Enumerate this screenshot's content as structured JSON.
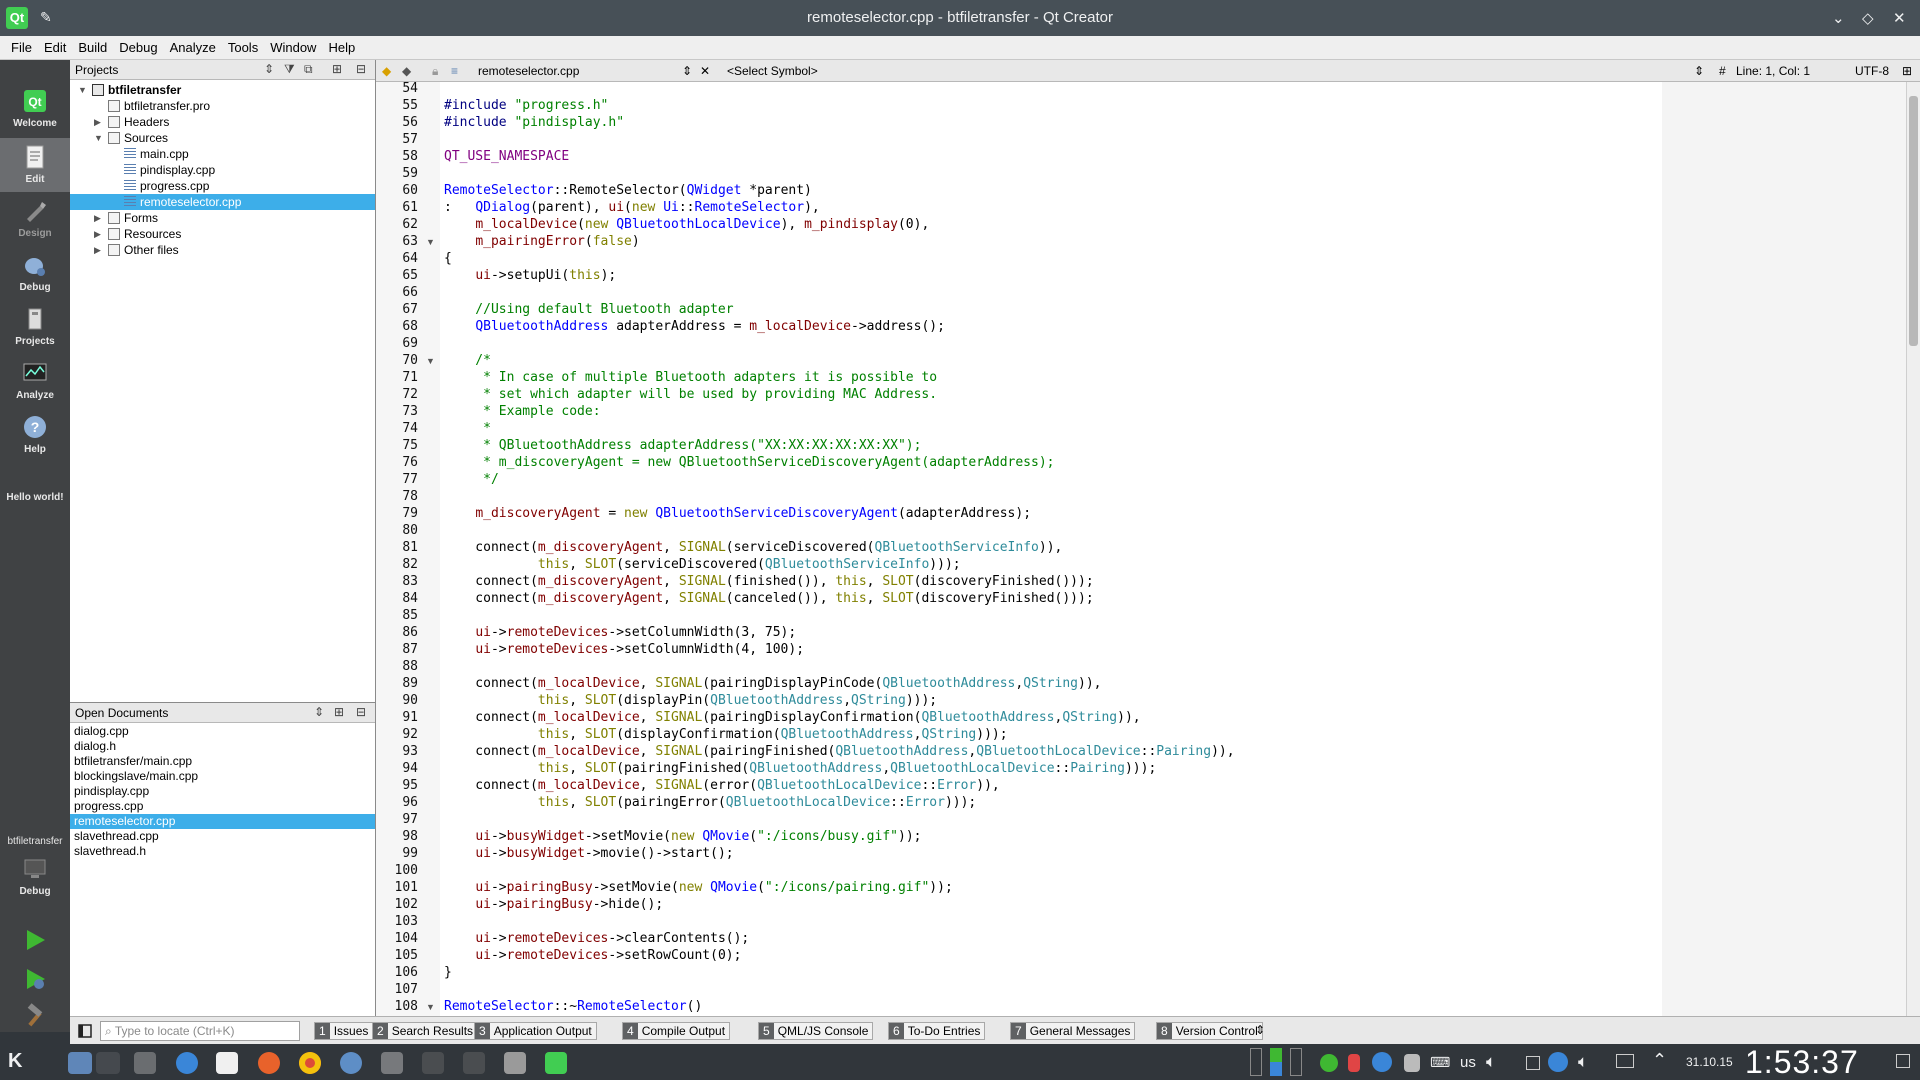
{
  "window": {
    "title": "remoteselector.cpp - btfiletransfer - Qt Creator",
    "app_icon": "Qt"
  },
  "menu": [
    "File",
    "Edit",
    "Build",
    "Debug",
    "Analyze",
    "Tools",
    "Window",
    "Help"
  ],
  "modes": [
    {
      "label": "Welcome",
      "icon": "qt-logo-icon"
    },
    {
      "label": "Edit",
      "icon": "edit-document-icon"
    },
    {
      "label": "Design",
      "icon": "design-pen-icon"
    },
    {
      "label": "Debug",
      "icon": "debug-bug-icon"
    },
    {
      "label": "Projects",
      "icon": "projects-wrench-icon"
    },
    {
      "label": "Analyze",
      "icon": "analyze-monitor-icon"
    },
    {
      "label": "Help",
      "icon": "help-question-icon"
    }
  ],
  "modebar": {
    "hello": "Hello world!",
    "kit_project": "btfiletransfer",
    "kit_mode": "Debug"
  },
  "projects": {
    "header": "Projects",
    "tree": [
      {
        "label": "btfiletransfer",
        "level": 0,
        "arrow": "▼",
        "icon": "project"
      },
      {
        "label": "btfiletransfer.pro",
        "level": 1,
        "arrow": "",
        "icon": "file"
      },
      {
        "label": "Headers",
        "level": 1,
        "arrow": "▶",
        "icon": "folder"
      },
      {
        "label": "Sources",
        "level": 1,
        "arrow": "▼",
        "icon": "folder"
      },
      {
        "label": "main.cpp",
        "level": 2,
        "arrow": "",
        "icon": "cpp"
      },
      {
        "label": "pindisplay.cpp",
        "level": 2,
        "arrow": "",
        "icon": "cpp"
      },
      {
        "label": "progress.cpp",
        "level": 2,
        "arrow": "",
        "icon": "cpp"
      },
      {
        "label": "remoteselector.cpp",
        "level": 2,
        "arrow": "",
        "icon": "cpp",
        "selected": true
      },
      {
        "label": "Forms",
        "level": 1,
        "arrow": "▶",
        "icon": "folder"
      },
      {
        "label": "Resources",
        "level": 1,
        "arrow": "▶",
        "icon": "folder"
      },
      {
        "label": "Other files",
        "level": 1,
        "arrow": "▶",
        "icon": "folder"
      }
    ]
  },
  "open_documents": {
    "header": "Open Documents",
    "items": [
      "dialog.cpp",
      "dialog.h",
      "btfiletransfer/main.cpp",
      "blockingslave/main.cpp",
      "pindisplay.cpp",
      "progress.cpp",
      "remoteselector.cpp",
      "slavethread.cpp",
      "slavethread.h"
    ],
    "selected_index": 6
  },
  "editor_toolbar": {
    "file": "remoteselector.cpp",
    "symbol": "<Select Symbol>",
    "hash": "#",
    "position": "Line: 1, Col: 1",
    "encoding": "UTF-8"
  },
  "code": {
    "first_line": 54,
    "fold_lines": [
      63,
      70,
      108
    ],
    "lines": [
      [],
      [
        [
          "#include ",
          "pp"
        ],
        [
          "\"progress.h\"",
          "st"
        ]
      ],
      [
        [
          "#include ",
          "pp"
        ],
        [
          "\"pindisplay.h\"",
          "st"
        ]
      ],
      [],
      [
        [
          "QT_USE_NAMESPACE",
          "mc"
        ]
      ],
      [],
      [
        [
          "RemoteSelector",
          "ty"
        ],
        [
          "::RemoteSelector(",
          ""
        ],
        [
          "QWidget",
          "ty"
        ],
        [
          " *parent)",
          ""
        ]
      ],
      [
        [
          ":   ",
          ""
        ],
        [
          "QDialog",
          "ty"
        ],
        [
          "(parent), ",
          ""
        ],
        [
          "ui",
          "mb"
        ],
        [
          "(",
          ""
        ],
        [
          "new ",
          "kw"
        ],
        [
          "Ui",
          "ty"
        ],
        [
          "::",
          ""
        ],
        [
          "RemoteSelector",
          "ty"
        ],
        [
          "),",
          ""
        ]
      ],
      [
        [
          "    ",
          ""
        ],
        [
          "m_localDevice",
          "mb"
        ],
        [
          "(",
          ""
        ],
        [
          "new ",
          "kw"
        ],
        [
          "QBluetoothLocalDevice",
          "ty"
        ],
        [
          "), ",
          ""
        ],
        [
          "m_pindisplay",
          "mb"
        ],
        [
          "(0),",
          ""
        ]
      ],
      [
        [
          "    ",
          ""
        ],
        [
          "m_pairingError",
          "mb"
        ],
        [
          "(",
          ""
        ],
        [
          "false",
          "kw"
        ],
        [
          ")",
          ""
        ]
      ],
      [
        [
          "{",
          ""
        ]
      ],
      [
        [
          "    ",
          ""
        ],
        [
          "ui",
          "mb"
        ],
        [
          "->setupUi(",
          ""
        ],
        [
          "this",
          "kw"
        ],
        [
          ");",
          ""
        ]
      ],
      [],
      [
        [
          "    //Using default Bluetooth adapter",
          "cm"
        ]
      ],
      [
        [
          "    ",
          ""
        ],
        [
          "QBluetoothAddress",
          "ty"
        ],
        [
          " adapterAddress = ",
          ""
        ],
        [
          "m_localDevice",
          "mb"
        ],
        [
          "->address();",
          ""
        ]
      ],
      [],
      [
        [
          "    /*",
          "cm"
        ]
      ],
      [
        [
          "     * In case of multiple Bluetooth adapters it is possible to",
          "cm"
        ]
      ],
      [
        [
          "     * set which adapter will be used by providing MAC Address.",
          "cm"
        ]
      ],
      [
        [
          "     * Example code:",
          "cm"
        ]
      ],
      [
        [
          "     *",
          "cm"
        ]
      ],
      [
        [
          "     * QBluetoothAddress adapterAddress(\"XX:XX:XX:XX:XX:XX\");",
          "cm"
        ]
      ],
      [
        [
          "     * m_discoveryAgent = new QBluetoothServiceDiscoveryAgent(adapterAddress);",
          "cm"
        ]
      ],
      [
        [
          "     */",
          "cm"
        ]
      ],
      [],
      [
        [
          "    ",
          ""
        ],
        [
          "m_discoveryAgent",
          "mb"
        ],
        [
          " = ",
          ""
        ],
        [
          "new ",
          "kw"
        ],
        [
          "QBluetoothServiceDiscoveryAgent",
          "ty"
        ],
        [
          "(adapterAddress);",
          ""
        ]
      ],
      [],
      [
        [
          "    connect(",
          ""
        ],
        [
          "m_discoveryAgent",
          "mb"
        ],
        [
          ", ",
          ""
        ],
        [
          "SIGNAL",
          "kw"
        ],
        [
          "(serviceDiscovered(",
          ""
        ],
        [
          "QBluetoothServiceInfo",
          "ty2"
        ],
        [
          ")),",
          ""
        ]
      ],
      [
        [
          "            ",
          ""
        ],
        [
          "this",
          "kw"
        ],
        [
          ", ",
          ""
        ],
        [
          "SLOT",
          "kw"
        ],
        [
          "(serviceDiscovered(",
          ""
        ],
        [
          "QBluetoothServiceInfo",
          "ty2"
        ],
        [
          ")));",
          ""
        ]
      ],
      [
        [
          "    connect(",
          ""
        ],
        [
          "m_discoveryAgent",
          "mb"
        ],
        [
          ", ",
          ""
        ],
        [
          "SIGNAL",
          "kw"
        ],
        [
          "(finished()), ",
          ""
        ],
        [
          "this",
          "kw"
        ],
        [
          ", ",
          ""
        ],
        [
          "SLOT",
          "kw"
        ],
        [
          "(discoveryFinished()));",
          ""
        ]
      ],
      [
        [
          "    connect(",
          ""
        ],
        [
          "m_discoveryAgent",
          "mb"
        ],
        [
          ", ",
          ""
        ],
        [
          "SIGNAL",
          "kw"
        ],
        [
          "(canceled()), ",
          ""
        ],
        [
          "this",
          "kw"
        ],
        [
          ", ",
          ""
        ],
        [
          "SLOT",
          "kw"
        ],
        [
          "(discoveryFinished()));",
          ""
        ]
      ],
      [],
      [
        [
          "    ",
          ""
        ],
        [
          "ui",
          "mb"
        ],
        [
          "->",
          ""
        ],
        [
          "remoteDevices",
          "mb"
        ],
        [
          "->setColumnWidth(3, 75);",
          ""
        ]
      ],
      [
        [
          "    ",
          ""
        ],
        [
          "ui",
          "mb"
        ],
        [
          "->",
          ""
        ],
        [
          "remoteDevices",
          "mb"
        ],
        [
          "->setColumnWidth(4, 100);",
          ""
        ]
      ],
      [],
      [
        [
          "    connect(",
          ""
        ],
        [
          "m_localDevice",
          "mb"
        ],
        [
          ", ",
          ""
        ],
        [
          "SIGNAL",
          "kw"
        ],
        [
          "(pairingDisplayPinCode(",
          ""
        ],
        [
          "QBluetoothAddress",
          "ty2"
        ],
        [
          ",",
          ""
        ],
        [
          "QString",
          "ty2"
        ],
        [
          ")),",
          ""
        ]
      ],
      [
        [
          "            ",
          ""
        ],
        [
          "this",
          "kw"
        ],
        [
          ", ",
          ""
        ],
        [
          "SLOT",
          "kw"
        ],
        [
          "(displayPin(",
          ""
        ],
        [
          "QBluetoothAddress",
          "ty2"
        ],
        [
          ",",
          ""
        ],
        [
          "QString",
          "ty2"
        ],
        [
          ")));",
          ""
        ]
      ],
      [
        [
          "    connect(",
          ""
        ],
        [
          "m_localDevice",
          "mb"
        ],
        [
          ", ",
          ""
        ],
        [
          "SIGNAL",
          "kw"
        ],
        [
          "(pairingDisplayConfirmation(",
          ""
        ],
        [
          "QBluetoothAddress",
          "ty2"
        ],
        [
          ",",
          ""
        ],
        [
          "QString",
          "ty2"
        ],
        [
          ")),",
          ""
        ]
      ],
      [
        [
          "            ",
          ""
        ],
        [
          "this",
          "kw"
        ],
        [
          ", ",
          ""
        ],
        [
          "SLOT",
          "kw"
        ],
        [
          "(displayConfirmation(",
          ""
        ],
        [
          "QBluetoothAddress",
          "ty2"
        ],
        [
          ",",
          ""
        ],
        [
          "QString",
          "ty2"
        ],
        [
          ")));",
          ""
        ]
      ],
      [
        [
          "    connect(",
          ""
        ],
        [
          "m_localDevice",
          "mb"
        ],
        [
          ", ",
          ""
        ],
        [
          "SIGNAL",
          "kw"
        ],
        [
          "(pairingFinished(",
          ""
        ],
        [
          "QBluetoothAddress",
          "ty2"
        ],
        [
          ",",
          ""
        ],
        [
          "QBluetoothLocalDevice",
          "ty2"
        ],
        [
          "::",
          ""
        ],
        [
          "Pairing",
          "ty2"
        ],
        [
          ")),",
          ""
        ]
      ],
      [
        [
          "            ",
          ""
        ],
        [
          "this",
          "kw"
        ],
        [
          ", ",
          ""
        ],
        [
          "SLOT",
          "kw"
        ],
        [
          "(pairingFinished(",
          ""
        ],
        [
          "QBluetoothAddress",
          "ty2"
        ],
        [
          ",",
          ""
        ],
        [
          "QBluetoothLocalDevice",
          "ty2"
        ],
        [
          "::",
          ""
        ],
        [
          "Pairing",
          "ty2"
        ],
        [
          ")));",
          ""
        ]
      ],
      [
        [
          "    connect(",
          ""
        ],
        [
          "m_localDevice",
          "mb"
        ],
        [
          ", ",
          ""
        ],
        [
          "SIGNAL",
          "kw"
        ],
        [
          "(error(",
          ""
        ],
        [
          "QBluetoothLocalDevice",
          "ty2"
        ],
        [
          "::",
          ""
        ],
        [
          "Error",
          "ty2"
        ],
        [
          ")),",
          ""
        ]
      ],
      [
        [
          "            ",
          ""
        ],
        [
          "this",
          "kw"
        ],
        [
          ", ",
          ""
        ],
        [
          "SLOT",
          "kw"
        ],
        [
          "(pairingError(",
          ""
        ],
        [
          "QBluetoothLocalDevice",
          "ty2"
        ],
        [
          "::",
          ""
        ],
        [
          "Error",
          "ty2"
        ],
        [
          ")));",
          ""
        ]
      ],
      [],
      [
        [
          "    ",
          ""
        ],
        [
          "ui",
          "mb"
        ],
        [
          "->",
          ""
        ],
        [
          "busyWidget",
          "mb"
        ],
        [
          "->setMovie(",
          ""
        ],
        [
          "new ",
          "kw"
        ],
        [
          "QMovie",
          "ty"
        ],
        [
          "(",
          ""
        ],
        [
          "\":/icons/busy.gif\"",
          "st"
        ],
        [
          "));",
          ""
        ]
      ],
      [
        [
          "    ",
          ""
        ],
        [
          "ui",
          "mb"
        ],
        [
          "->",
          ""
        ],
        [
          "busyWidget",
          "mb"
        ],
        [
          "->movie()->start();",
          ""
        ]
      ],
      [],
      [
        [
          "    ",
          ""
        ],
        [
          "ui",
          "mb"
        ],
        [
          "->",
          ""
        ],
        [
          "pairingBusy",
          "mb"
        ],
        [
          "->setMovie(",
          ""
        ],
        [
          "new ",
          "kw"
        ],
        [
          "QMovie",
          "ty"
        ],
        [
          "(",
          ""
        ],
        [
          "\":/icons/pairing.gif\"",
          "st"
        ],
        [
          "));",
          ""
        ]
      ],
      [
        [
          "    ",
          ""
        ],
        [
          "ui",
          "mb"
        ],
        [
          "->",
          ""
        ],
        [
          "pairingBusy",
          "mb"
        ],
        [
          "->hide();",
          ""
        ]
      ],
      [],
      [
        [
          "    ",
          ""
        ],
        [
          "ui",
          "mb"
        ],
        [
          "->",
          ""
        ],
        [
          "remoteDevices",
          "mb"
        ],
        [
          "->clearContents();",
          ""
        ]
      ],
      [
        [
          "    ",
          ""
        ],
        [
          "ui",
          "mb"
        ],
        [
          "->",
          ""
        ],
        [
          "remoteDevices",
          "mb"
        ],
        [
          "->setRowCount(0);",
          ""
        ]
      ],
      [
        [
          "}",
          ""
        ]
      ],
      [],
      [
        [
          "RemoteSelector",
          "ty"
        ],
        [
          "::~",
          ""
        ],
        [
          "RemoteSelector",
          "ty"
        ],
        [
          "()",
          ""
        ]
      ]
    ]
  },
  "locator_placeholder": "Type to locate (Ctrl+K)",
  "output_tabs": [
    {
      "num": "1",
      "label": "Issues"
    },
    {
      "num": "2",
      "label": "Search Results"
    },
    {
      "num": "3",
      "label": "Application Output"
    },
    {
      "num": "4",
      "label": "Compile Output"
    },
    {
      "num": "5",
      "label": "QML/JS Console"
    },
    {
      "num": "6",
      "label": "To-Do Entries"
    },
    {
      "num": "7",
      "label": "General Messages"
    },
    {
      "num": "8",
      "label": "Version Control"
    }
  ],
  "taskbar": {
    "keyboard_layout": "us",
    "date": "31.10.15",
    "time": "1:53:37"
  },
  "colors": {
    "selection": "#3daee9",
    "modebar": "#404244",
    "qt_green": "#41cd52",
    "taskbar": "#31363b"
  }
}
